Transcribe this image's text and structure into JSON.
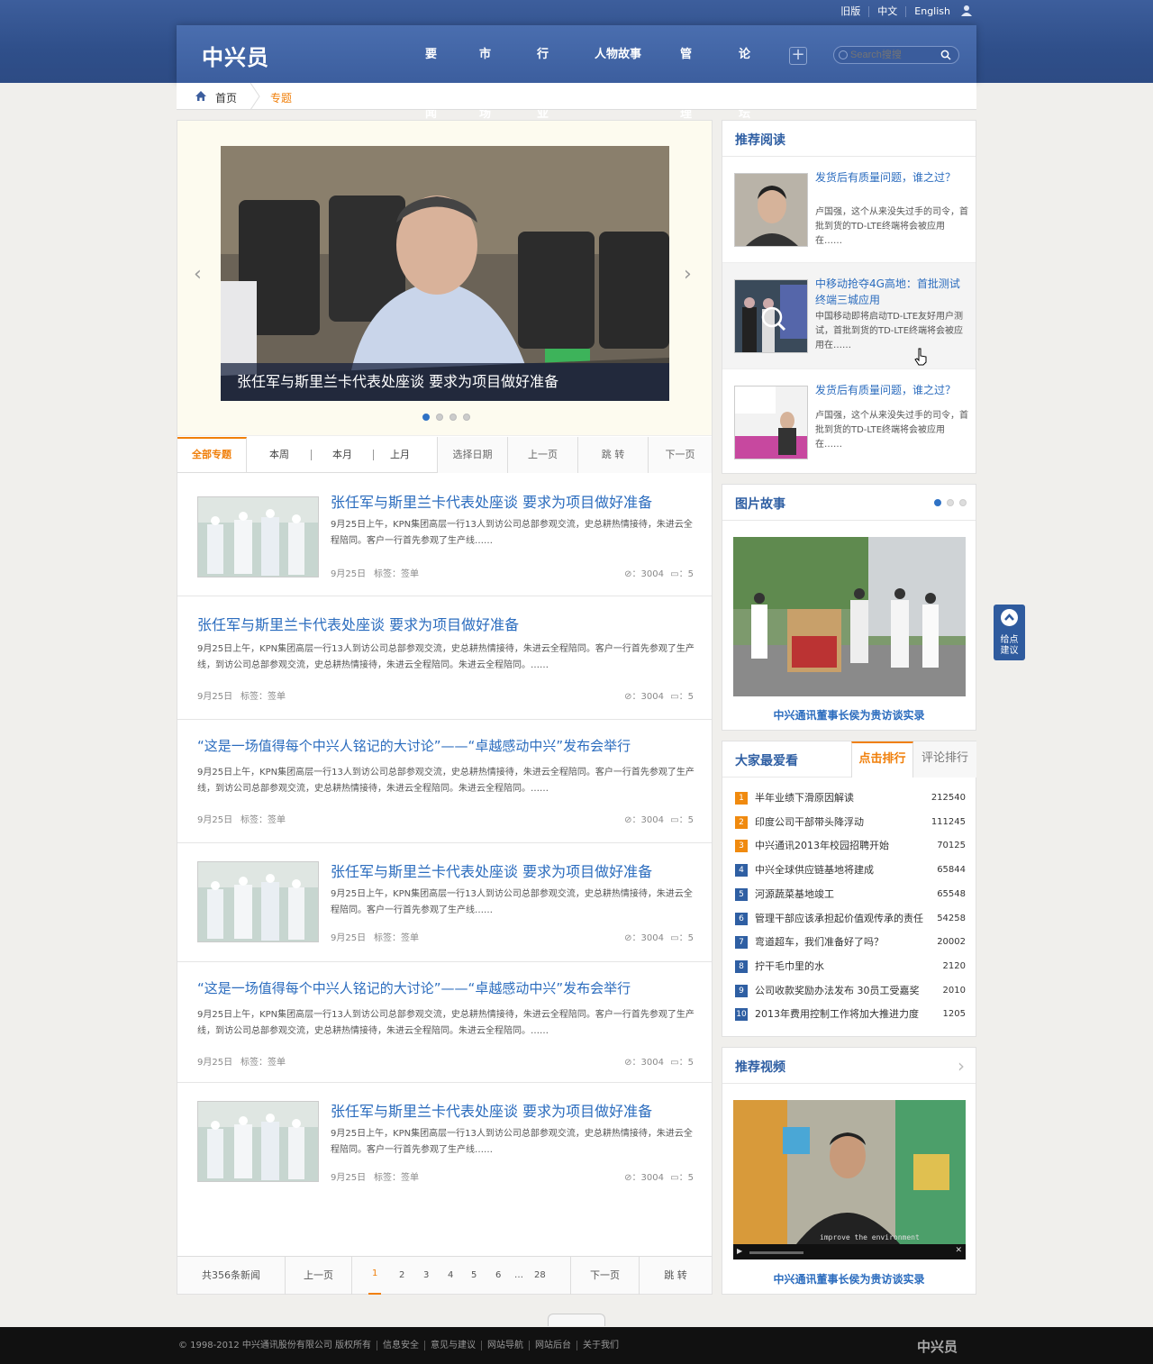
{
  "header": {
    "logo": "中兴员",
    "top_links": [
      "旧版",
      "中文",
      "English"
    ],
    "nav": [
      "要闻",
      "市场",
      "行业",
      "人物故事",
      "管理",
      "论坛"
    ],
    "search_placeholder": "Search搜搜"
  },
  "breadcrumb": {
    "home": "首页",
    "current": "专题"
  },
  "slider": {
    "caption": "张任军与斯里兰卡代表处座谈 要求为项目做好准备",
    "dots": 4,
    "active_dot": 1
  },
  "filter_tabs": {
    "all": "全部专题",
    "week": "本周",
    "month": "本月",
    "last_month": "上月",
    "choose_date": "选择日期",
    "prev": "上一页",
    "jump": "跳 转",
    "next": "下一页"
  },
  "articles": [
    {
      "title": "张任军与斯里兰卡代表处座谈 要求为项目做好准备",
      "summary": "9月25日上午，KPN集团高层一行13人到访公司总部参观交流，史总耕热情接待，朱进云全程陪同。客户一行首先参观了生产线……",
      "date": "9月25日",
      "tag": "标签：签单",
      "views": "：3004",
      "comments": "：5",
      "has_image": true
    },
    {
      "title": "张任军与斯里兰卡代表处座谈 要求为项目做好准备",
      "summary": "9月25日上午，KPN集团高层一行13人到访公司总部参观交流，史总耕热情接待，朱进云全程陪同。客户一行首先参观了生产线，到访公司总部参观交流，史总耕热情接待，朱进云全程陪同。朱进云全程陪同。……",
      "date": "9月25日",
      "tag": "标签：签单",
      "views": "：3004",
      "comments": "：5",
      "has_image": false
    },
    {
      "title": "“这是一场值得每个中兴人铭记的大讨论”——“卓越感动中兴”发布会举行",
      "summary": "9月25日上午，KPN集团高层一行13人到访公司总部参观交流，史总耕热情接待，朱进云全程陪同。客户一行首先参观了生产线，到访公司总部参观交流，史总耕热情接待，朱进云全程陪同。朱进云全程陪同。……",
      "date": "9月25日",
      "tag": "标签：签单",
      "views": "：3004",
      "comments": "：5",
      "has_image": false
    },
    {
      "title": "张任军与斯里兰卡代表处座谈 要求为项目做好准备",
      "summary": "9月25日上午，KPN集团高层一行13人到访公司总部参观交流，史总耕热情接待，朱进云全程陪同。客户一行首先参观了生产线……",
      "date": "9月25日",
      "tag": "标签：签单",
      "views": "：3004",
      "comments": "：5",
      "has_image": true
    },
    {
      "title": "“这是一场值得每个中兴人铭记的大讨论”——“卓越感动中兴”发布会举行",
      "summary": "9月25日上午，KPN集团高层一行13人到访公司总部参观交流，史总耕热情接待，朱进云全程陪同。客户一行首先参观了生产线，到访公司总部参观交流，史总耕热情接待，朱进云全程陪同。朱进云全程陪同。……",
      "date": "9月25日",
      "tag": "标签：签单",
      "views": "：3004",
      "comments": "：5",
      "has_image": false
    },
    {
      "title": "张任军与斯里兰卡代表处座谈 要求为项目做好准备",
      "summary": "9月25日上午，KPN集团高层一行13人到访公司总部参观交流，史总耕热情接待，朱进云全程陪同。客户一行首先参观了生产线……",
      "date": "9月25日",
      "tag": "标签：签单",
      "views": "：3004",
      "comments": "：5",
      "has_image": true
    }
  ],
  "pager": {
    "total": "共356条新闻",
    "prev": "上一页",
    "pages": [
      "1",
      "2",
      "3",
      "4",
      "5",
      "6",
      "…",
      "28"
    ],
    "current": "1",
    "next": "下一页",
    "jump": "跳 转"
  },
  "recommend": {
    "title": "推荐阅读",
    "items": [
      {
        "title": "发货后有质量问题，谁之过？",
        "desc": "卢国强，这个从来没失过手的司令，首批到货的TD-LTE终端将会被应用在……"
      },
      {
        "title": "中移动抢夺4G高地：首批测试终端三城应用",
        "desc": "中国移动即将启动TD-LTE友好用户测试，首批到货的TD-LTE终端将会被应用在……"
      },
      {
        "title": "发货后有质量问题，谁之过？",
        "desc": "卢国强，这个从来没失过手的司令，首批到货的TD-LTE终端将会被应用在……"
      }
    ]
  },
  "photo_story": {
    "title": "图片故事",
    "caption": "中兴通讯董事长侯为贵访谈实录",
    "dots": 3,
    "active_dot": 1
  },
  "popular": {
    "title": "大家最爱看",
    "tab_clicks": "点击排行",
    "tab_comments": "评论排行",
    "items": [
      {
        "rank": "1",
        "text": "半年业绩下滑原因解读",
        "count": "212540"
      },
      {
        "rank": "2",
        "text": "印度公司干部带头降浮动",
        "count": "111245"
      },
      {
        "rank": "3",
        "text": "中兴通讯2013年校园招聘开始",
        "count": "70125"
      },
      {
        "rank": "4",
        "text": "中兴全球供应链基地将建成",
        "count": "65844"
      },
      {
        "rank": "5",
        "text": "河源蔬菜基地竣工",
        "count": "65548"
      },
      {
        "rank": "6",
        "text": "管理干部应该承担起价值观传承的责任",
        "count": "54258"
      },
      {
        "rank": "7",
        "text": "弯道超车，我们准备好了吗？",
        "count": "20002"
      },
      {
        "rank": "8",
        "text": "拧干毛巾里的水",
        "count": "2120"
      },
      {
        "rank": "9",
        "text": "公司收款奖励办法发布 30员工受嘉奖",
        "count": "2010"
      },
      {
        "rank": "10",
        "text": "2013年费用控制工作将加大推进力度",
        "count": "1205"
      }
    ]
  },
  "video": {
    "title": "推荐视频",
    "caption": "中兴通讯董事长侯为贵访谈实录",
    "subtitle_text": "improve the environment"
  },
  "feedback": {
    "label": "给点建议"
  },
  "footer": {
    "links": [
      "© 1998-2012  中兴通讯股份有限公司  版权所有",
      "信息安全",
      "意见与建议",
      "网站导航",
      "网站后台",
      "关于我们"
    ],
    "logo": "中兴员"
  },
  "colors": {
    "accent": "#f07f0a",
    "brand_blue": "#3c5e9e",
    "link": "#2b6cbe",
    "rank_orange": "#f08a0f",
    "rank_blue": "#2f5fa3"
  }
}
